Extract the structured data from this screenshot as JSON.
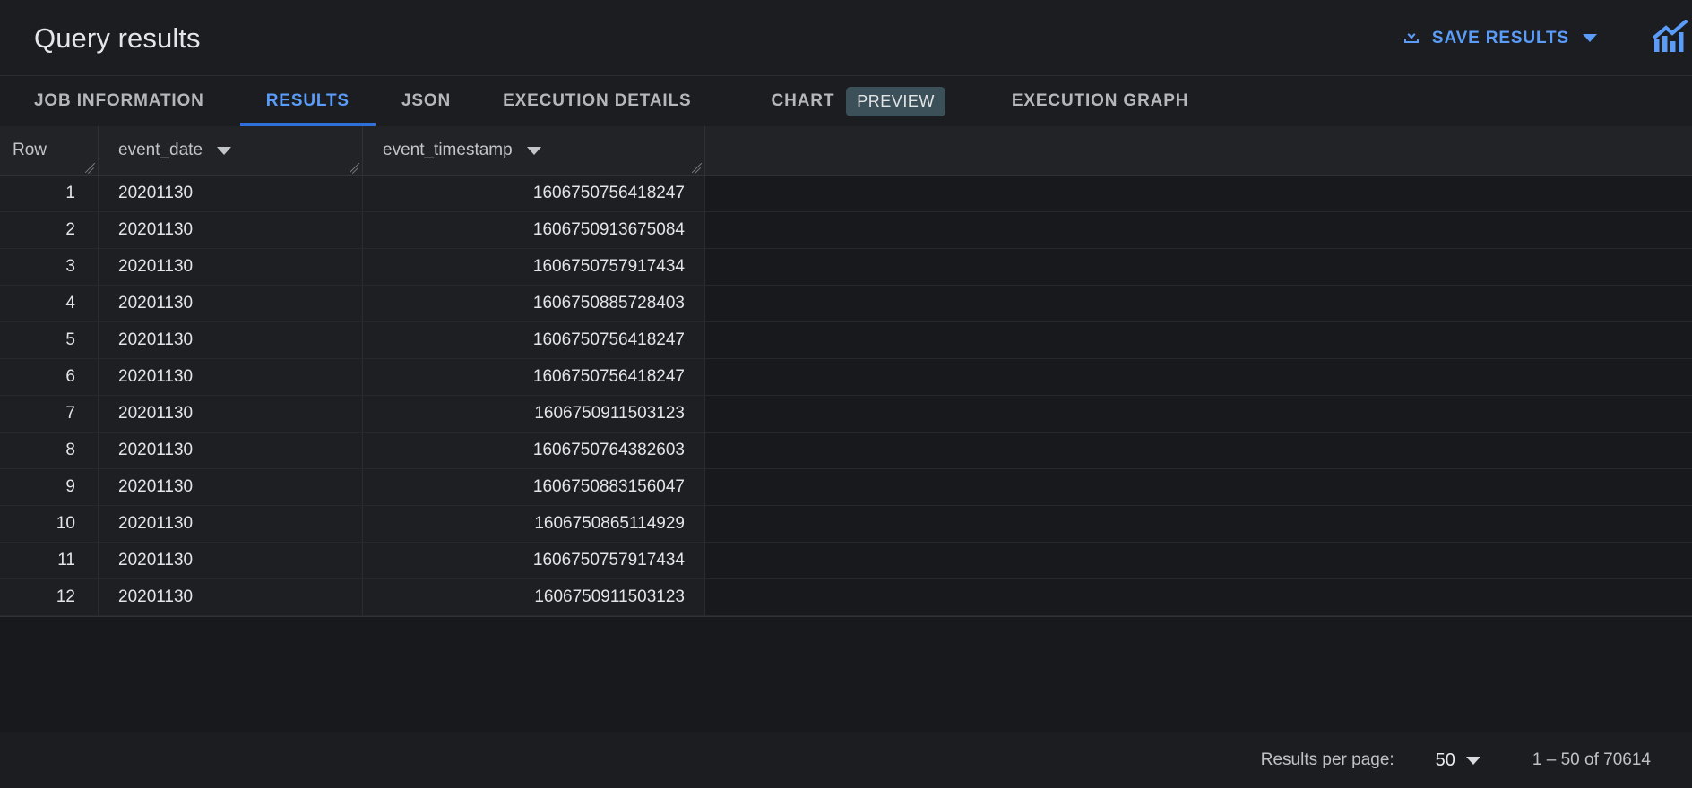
{
  "header": {
    "title": "Query results",
    "save_results_label": "SAVE RESULTS",
    "save_icon": "download-icon",
    "dropdown_icon": "chevron-down-icon",
    "chart_icon": "bar-chart-trend-icon",
    "accent_color": "#5a9cf8"
  },
  "tabs": [
    {
      "label": "JOB INFORMATION",
      "active": false
    },
    {
      "label": "RESULTS",
      "active": true
    },
    {
      "label": "JSON",
      "active": false
    },
    {
      "label": "EXECUTION DETAILS",
      "active": false
    },
    {
      "label": "CHART",
      "badge": "PREVIEW",
      "active": false
    },
    {
      "label": "EXECUTION GRAPH",
      "active": false
    }
  ],
  "table": {
    "columns": [
      {
        "label": "Row",
        "sortable": false
      },
      {
        "label": "event_date",
        "sortable": true
      },
      {
        "label": "event_timestamp",
        "sortable": true
      }
    ],
    "rows": [
      {
        "row": "1",
        "event_date": "20201130",
        "event_timestamp": "1606750756418247"
      },
      {
        "row": "2",
        "event_date": "20201130",
        "event_timestamp": "1606750913675084"
      },
      {
        "row": "3",
        "event_date": "20201130",
        "event_timestamp": "1606750757917434"
      },
      {
        "row": "4",
        "event_date": "20201130",
        "event_timestamp": "1606750885728403"
      },
      {
        "row": "5",
        "event_date": "20201130",
        "event_timestamp": "1606750756418247"
      },
      {
        "row": "6",
        "event_date": "20201130",
        "event_timestamp": "1606750756418247"
      },
      {
        "row": "7",
        "event_date": "20201130",
        "event_timestamp": "1606750911503123"
      },
      {
        "row": "8",
        "event_date": "20201130",
        "event_timestamp": "1606750764382603"
      },
      {
        "row": "9",
        "event_date": "20201130",
        "event_timestamp": "1606750883156047"
      },
      {
        "row": "10",
        "event_date": "20201130",
        "event_timestamp": "1606750865114929"
      },
      {
        "row": "11",
        "event_date": "20201130",
        "event_timestamp": "1606750757917434"
      },
      {
        "row": "12",
        "event_date": "20201130",
        "event_timestamp": "1606750911503123"
      }
    ]
  },
  "footer": {
    "results_per_page_label": "Results per page:",
    "results_per_page_value": "50",
    "range_label": "1 – 50 of 70614"
  }
}
